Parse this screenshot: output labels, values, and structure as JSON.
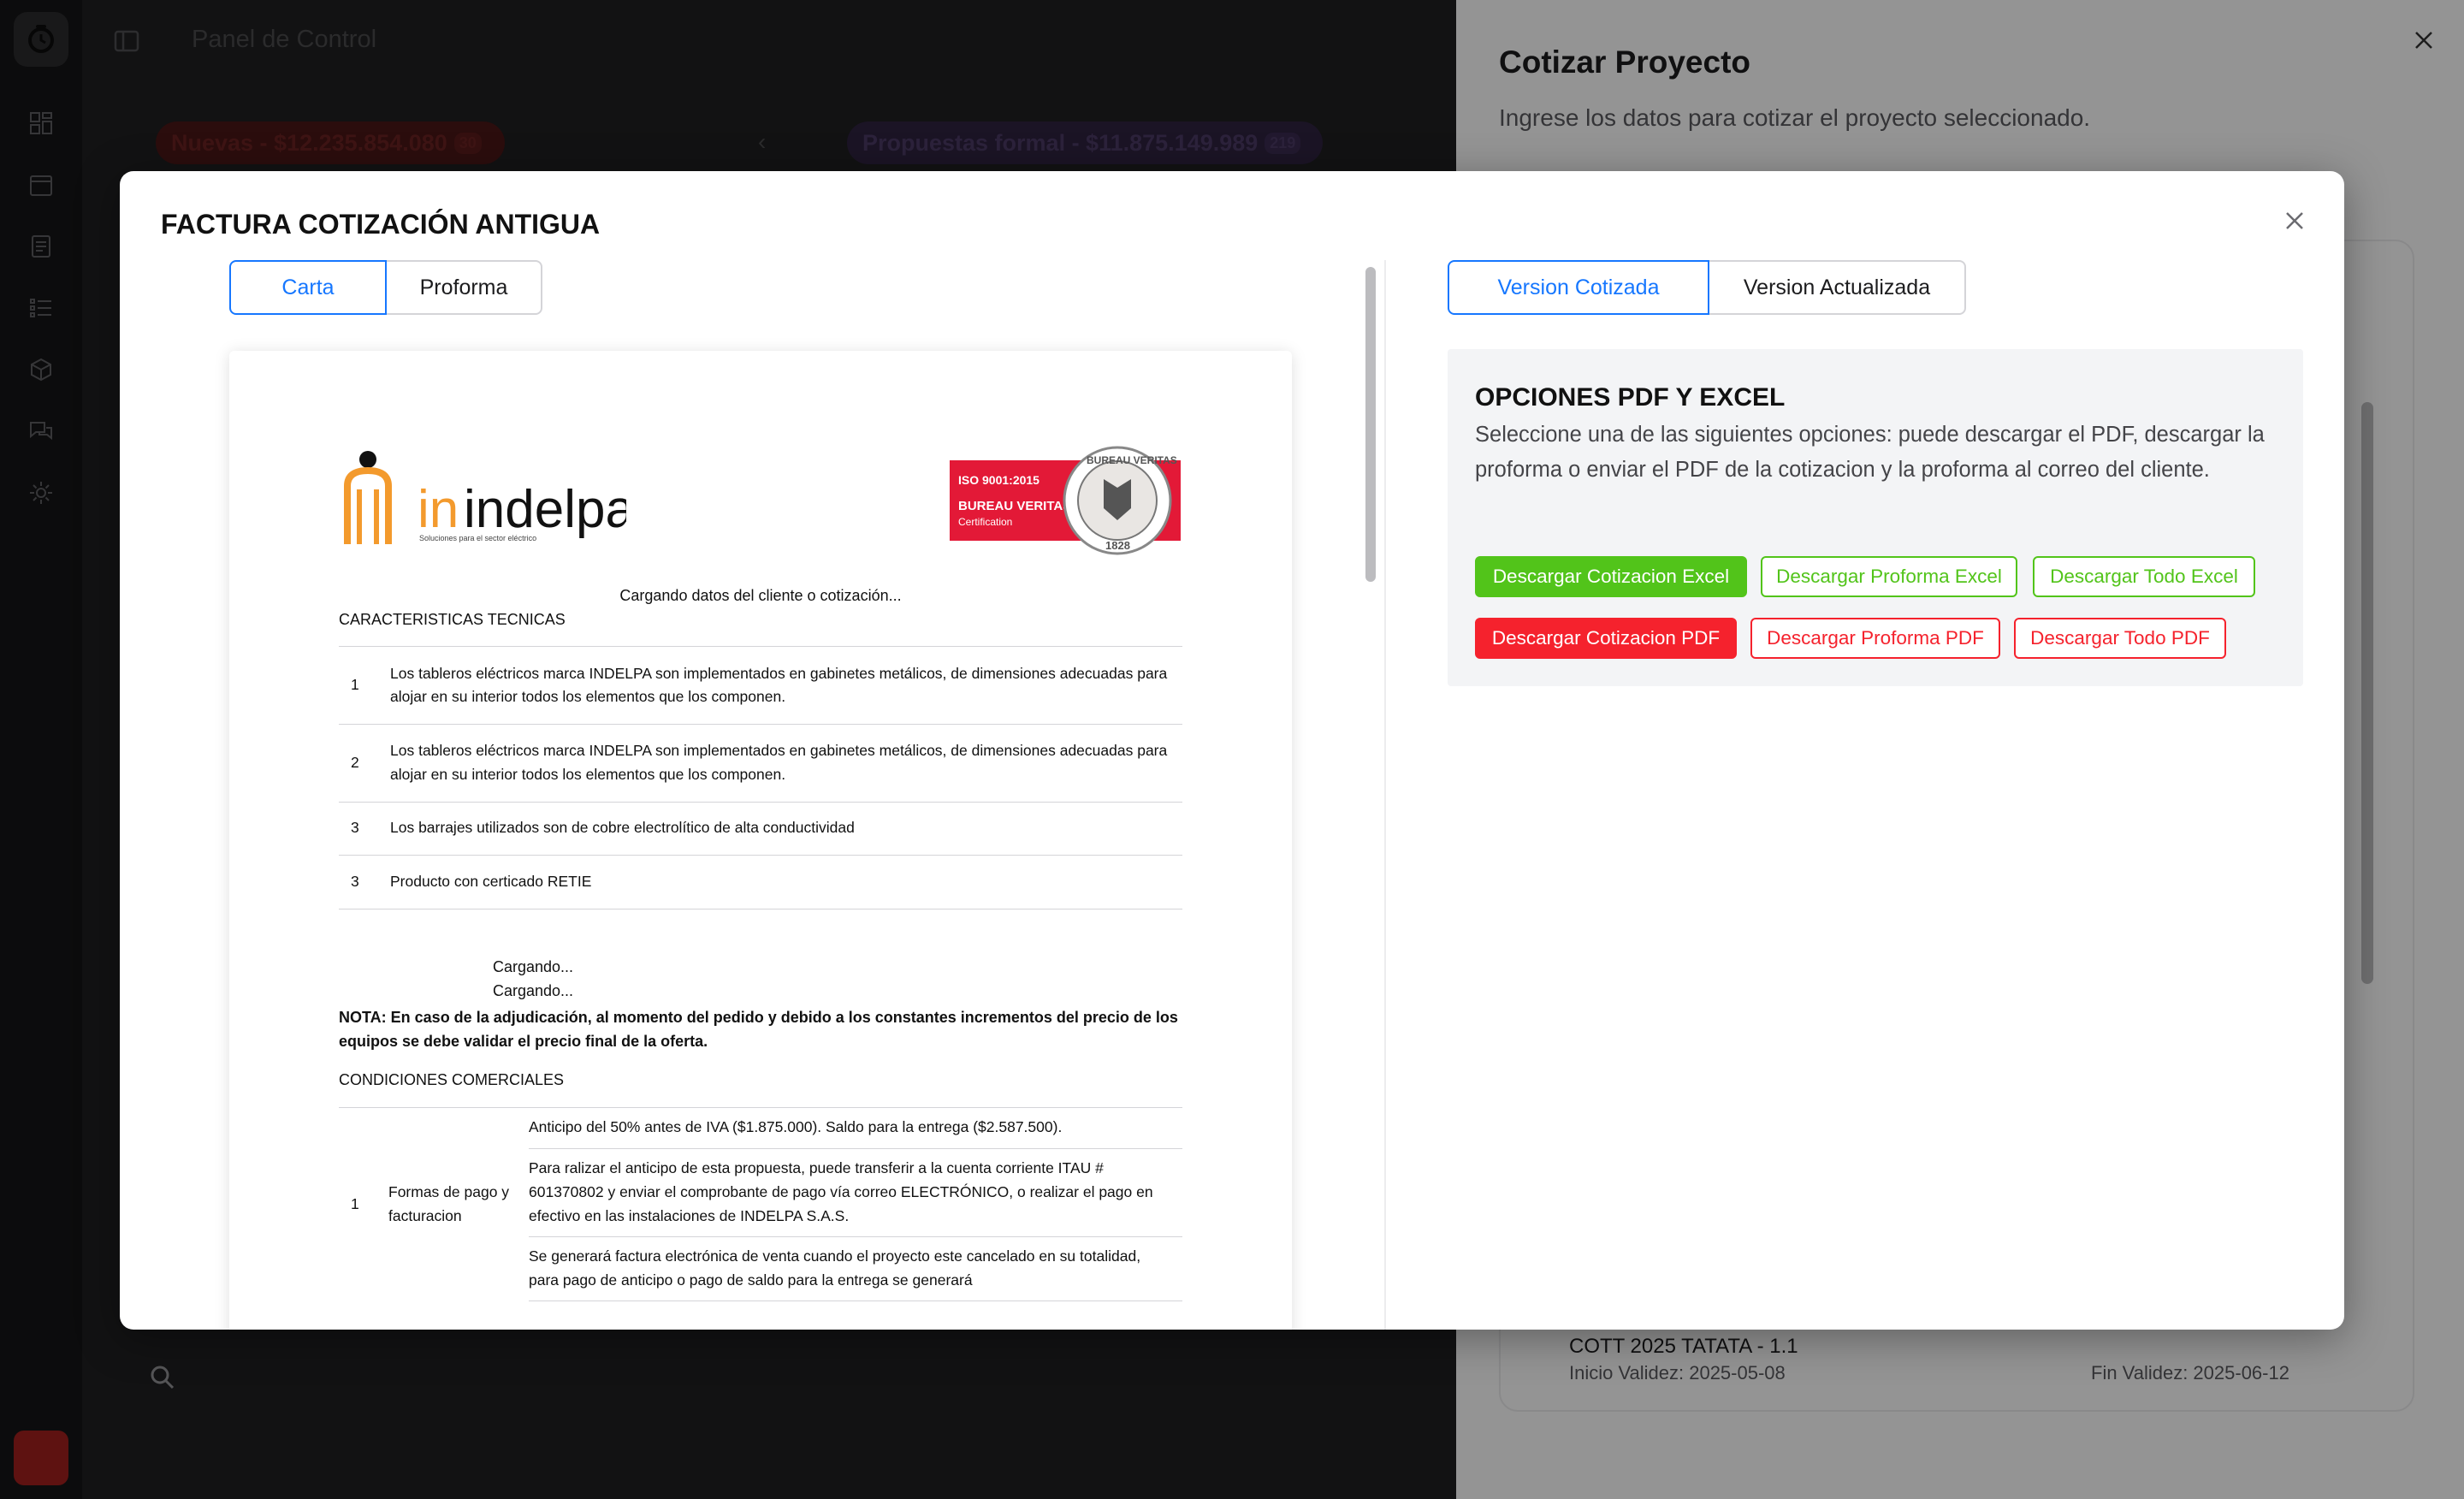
{
  "background": {
    "topbar_title": "Panel de Control",
    "pill_new": {
      "label": "Nuevas - $12.235.854.080",
      "count": "30"
    },
    "pill_proposals": {
      "label": "Propuestas formal - $11.875.149.989",
      "count": "219"
    },
    "side_panel": {
      "title": "Cotizar Proyecto",
      "subtitle": "Ingrese los datos para cotizar el proyecto seleccionado.",
      "card_title": "COTT 2025 TATATA - 1.1",
      "card_line_left": "Inicio Validez: 2025-05-08",
      "card_line_right": "Fin Validez: 2025-06-12"
    }
  },
  "modal": {
    "title": "FACTURA COTIZACIÓN ANTIGUA",
    "left_tabs": [
      "Carta",
      "Proforma"
    ],
    "right_tabs": [
      "Version Cotizada",
      "Version Actualizada"
    ]
  },
  "document": {
    "logo_name": "indelpa",
    "logo_tagline": "Soluciones para el sector eléctrico",
    "cert": {
      "iso": "ISO 9001:2015",
      "name": "BUREAU VERITAS",
      "sub": "Certification",
      "seal_text": "BUREAU VERITAS",
      "seal_year": "1828"
    },
    "loading_client": "Cargando datos del cliente o cotización...",
    "tech_heading": "CARACTERISTICAS TECNICAS",
    "tech_rows": [
      {
        "num": "1",
        "text": "Los tableros eléctricos marca INDELPA son implementados en gabinetes metálicos, de dimensiones adecuadas para alojar en su interior todos los elementos que los componen."
      },
      {
        "num": "2",
        "text": "Los tableros eléctricos marca INDELPA son implementados en gabinetes metálicos, de dimensiones adecuadas para alojar en su interior todos los elementos que los componen."
      },
      {
        "num": "3",
        "text": "Los barrajes utilizados son de cobre electrolítico de alta conductividad"
      },
      {
        "num": "3",
        "text": "Producto con certicado RETIE"
      }
    ],
    "loading_1": "Cargando...",
    "loading_2": "Cargando...",
    "note": "NOTA: En caso de la adjudicación, al momento del pedido y debido a los constantes incrementos del precio de los equipos se debe validar el precio final de la oferta.",
    "commercial_heading": "CONDICIONES COMERCIALES",
    "commercial": {
      "num": "1",
      "label": "Formas de pago y facturacion",
      "values": [
        "Anticipo del 50% antes de IVA ($1.875.000). Saldo para la entrega ($2.587.500).",
        "Para ralizar el anticipo de esta propuesta, puede transferir a la cuenta corriente ITAU # 601370802 y enviar el comprobante de pago vía correo ELECTRÓNICO, o realizar el pago en efectivo en las instalaciones de INDELPA S.A.S.",
        "Se generará factura electrónica de venta cuando el proyecto este cancelado en su totalidad, para pago de anticipo o pago de saldo para la entrega se generará"
      ]
    }
  },
  "options": {
    "title": "OPCIONES PDF Y EXCEL",
    "description": "Seleccione una de las siguientes opciones: puede descargar el PDF, descargar la proforma o enviar el PDF de la cotizacion y la proforma al correo del cliente.",
    "excel_buttons": [
      "Descargar Cotizacion Excel",
      "Descargar Proforma Excel",
      "Descargar Todo Excel"
    ],
    "pdf_buttons": [
      "Descargar Cotizacion PDF",
      "Descargar Proforma PDF",
      "Descargar Todo PDF"
    ],
    "colors": {
      "excel": "#52c41a",
      "pdf": "#f5222d",
      "accent": "#1677ff"
    }
  }
}
